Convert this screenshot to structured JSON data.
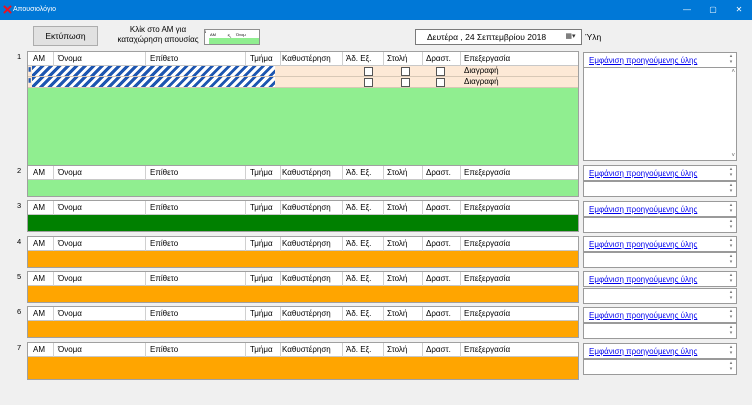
{
  "window": {
    "title": "Απουσιολόγιο",
    "min_glyph": "—",
    "max_glyph": "▢",
    "close_glyph": "✕"
  },
  "toolbar": {
    "print_label": "Εκτύπωση",
    "hint_line1": "Κλίκ στο ΑΜ για",
    "hint_line2": "καταχώρηση απουσίας",
    "mini_table": {
      "row_number": "1",
      "col_am": "AM",
      "col_name": "Όνομ"
    },
    "date": "Δευτέρα , 24 Σεπτεμβρίου 2018",
    "date_icon": "calendar-dropdown-icon",
    "subject_label": "Ύλη"
  },
  "columns": {
    "am": "ΑΜ",
    "name": "Όνομα",
    "surname": "Επίθετο",
    "dept": "Τμήμα",
    "late": "Καθυστέρηση",
    "excuse": "Άδ. Εξ.",
    "uniform": "Στολή",
    "activity": "Δραστ.",
    "edit": "Επεξεργασία"
  },
  "delete_label": "Διαγραφή",
  "show_previous_label": "Εμφάνιση προηγούμενης ύλης",
  "groups": [
    {
      "number": "1",
      "fill": "#90ee90"
    },
    {
      "number": "2",
      "fill": "#90ee90"
    },
    {
      "number": "3",
      "fill": "#008000"
    },
    {
      "number": "4",
      "fill": "#ffa500"
    },
    {
      "number": "5",
      "fill": "#ffa500"
    },
    {
      "number": "6",
      "fill": "#ffa500"
    },
    {
      "number": "7",
      "fill": "#ffa500"
    }
  ]
}
